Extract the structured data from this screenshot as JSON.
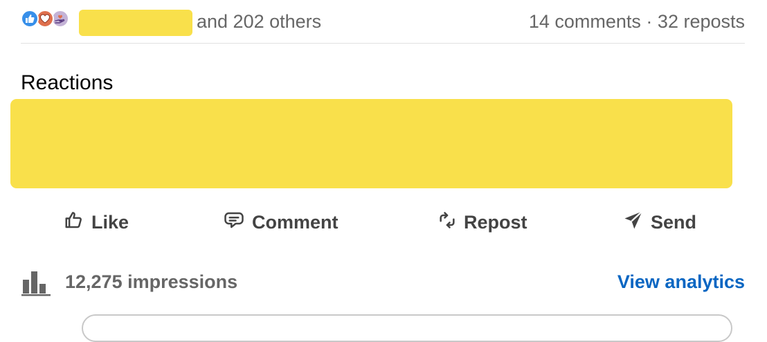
{
  "social_counts": {
    "reaction_icons": [
      "like-icon",
      "love-icon",
      "support-icon"
    ],
    "others_text": "and 202 others",
    "comments_text": "14 comments",
    "separator": "·",
    "reposts_text": "32 reposts"
  },
  "reactions": {
    "title": "Reactions"
  },
  "actions": {
    "like": "Like",
    "comment": "Comment",
    "repost": "Repost",
    "send": "Send"
  },
  "analytics": {
    "impressions_text": "12,275 impressions",
    "view_label": "View analytics"
  },
  "colors": {
    "link": "#0a66c2",
    "redaction": "#f9e04b",
    "muted_text": "#666666",
    "like_icon_bg": "#378fe9",
    "love_icon_bg": "#df704d",
    "support_icon_bg": "#c4b3d6"
  }
}
